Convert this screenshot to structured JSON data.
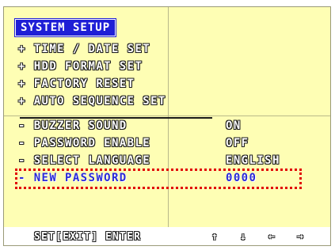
{
  "title": "SYSTEM SETUP",
  "menu": [
    {
      "bullet": "+",
      "label": "TIME / DATE SET",
      "value": ""
    },
    {
      "bullet": "+",
      "label": "HDD FORMAT SET",
      "value": ""
    },
    {
      "bullet": "+",
      "label": "FACTORY RESET",
      "value": ""
    },
    {
      "bullet": "+",
      "label": "AUTO SEQUENCE SET",
      "value": ""
    },
    {
      "bullet": "-",
      "label": "BUZZER SOUND",
      "value": "ON"
    },
    {
      "bullet": "-",
      "label": "PASSWORD ENABLE",
      "value": "OFF"
    },
    {
      "bullet": "-",
      "label": "SELECT LANGUAGE",
      "value": "ENGLISH"
    },
    {
      "bullet": "-",
      "label": "NEW PASSWORD",
      "value": "0000"
    }
  ],
  "footer": {
    "set_exit": "SET[EXIT]",
    "enter": "ENTER",
    "up": "↑",
    "down": "↓",
    "left": "←",
    "right": "→"
  },
  "colors": {
    "background": "#fefeb4",
    "title_bg": "#1f1fd6",
    "selected_text": "#2a2ad8",
    "highlight_border": "#e00000"
  }
}
